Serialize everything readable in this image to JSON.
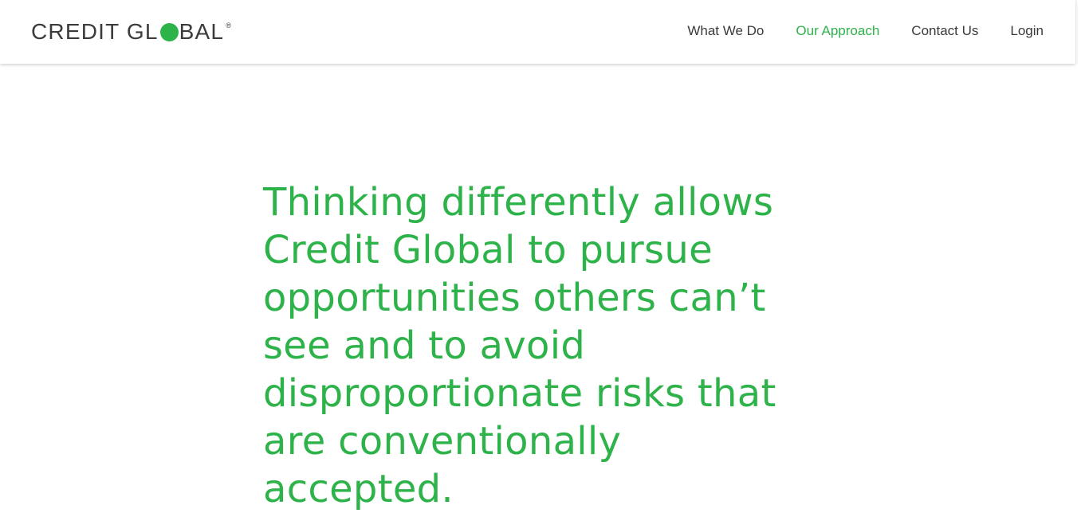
{
  "header": {
    "logo": {
      "text_before": "CREDIT GL",
      "text_after": "BAL",
      "registered_mark": "®",
      "dot_color": "#2eb24a"
    },
    "nav": [
      {
        "label": "What We Do",
        "active": false
      },
      {
        "label": "Our Approach",
        "active": true
      },
      {
        "label": "Contact Us",
        "active": false
      },
      {
        "label": "Login",
        "active": false
      }
    ]
  },
  "main": {
    "headline": "Thinking differently allows Credit Global to pursue opportunities others can’t see and to avoid disproportionate risks that are conventionally accepted."
  },
  "colors": {
    "accent": "#2eb24a",
    "text": "#3a3a3a",
    "background": "#ffffff"
  }
}
